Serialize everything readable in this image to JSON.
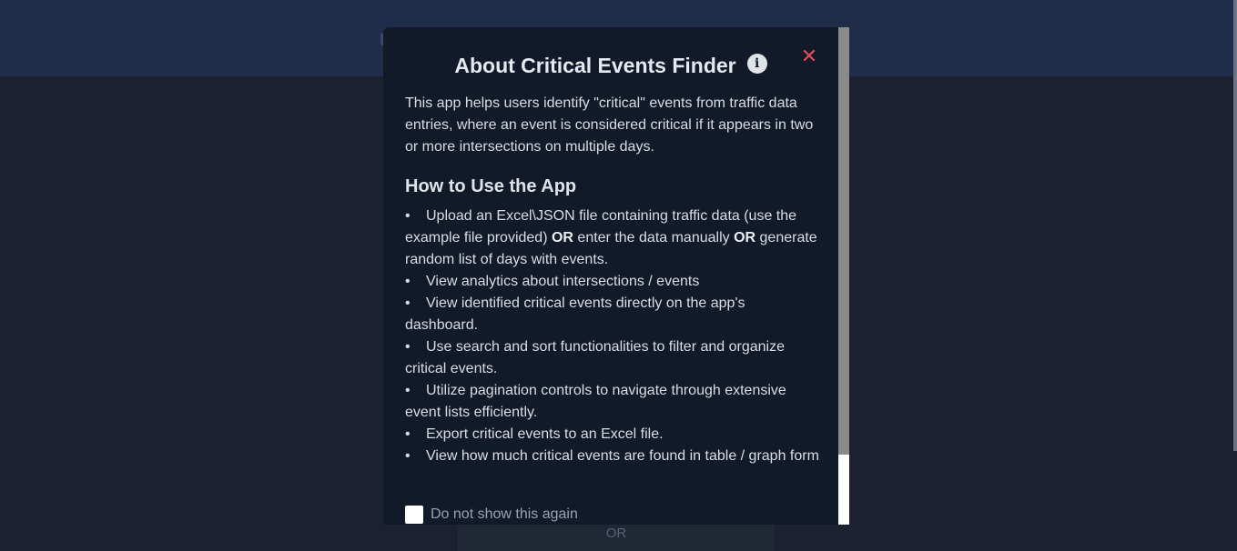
{
  "background": {
    "or_label": "OR"
  },
  "modal": {
    "title": "About Critical Events Finder",
    "info_glyph": "i",
    "close_glyph": "✕",
    "intro": "This app helps users identify \"critical\" events from traffic data entries, where an event is considered critical if it appears in two or more intersections on multiple days.",
    "how_to_heading": "How to Use the App",
    "steps": [
      {
        "part1": "Upload an Excel\\JSON file containing traffic data (use the example file provided) ",
        "bold1": "OR",
        "part2": " enter the data manually ",
        "bold2": "OR",
        "part3": " generate random list of days with events."
      },
      {
        "text": "View analytics about intersections / events"
      },
      {
        "text": "View identified critical events directly on the app's dashboard."
      },
      {
        "text": "Use search and sort functionalities to filter and organize critical events."
      },
      {
        "text": "Utilize pagination controls to navigate through extensive event lists efficiently."
      },
      {
        "text": "Export critical events to an Excel file."
      },
      {
        "text": "View how much critical events are found in table / graph form"
      }
    ],
    "checkbox_label": "Do not show this again",
    "checkbox_checked": false
  },
  "colors": {
    "header_bg": "#1f2d4a",
    "page_bg": "#1b2130",
    "modal_bg": "#121a29",
    "close_color": "#e34b5a"
  },
  "icons": {
    "info": "info-circle-icon",
    "close": "close-icon"
  }
}
